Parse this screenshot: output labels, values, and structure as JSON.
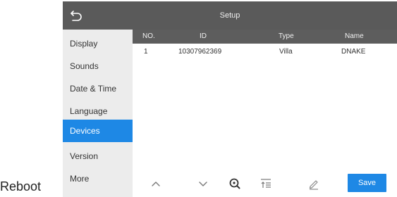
{
  "outside_label": "Reboot",
  "header": {
    "title": "Setup",
    "back_icon": "back-icon"
  },
  "sidebar": {
    "items": [
      {
        "label": "Display"
      },
      {
        "label": "Sounds"
      },
      {
        "label": "Date & Time"
      },
      {
        "label": "Language"
      },
      {
        "label": "Devices"
      },
      {
        "label": "Version"
      },
      {
        "label": "More"
      }
    ],
    "active": "Devices",
    "active_color": "#1e88e5"
  },
  "table": {
    "columns": [
      "NO.",
      "ID",
      "Type",
      "Name"
    ],
    "rows": [
      {
        "no": "1",
        "id": "10307962369",
        "type": "Villa",
        "name": "DNAKE"
      }
    ]
  },
  "toolbar": {
    "icons": [
      "chevron-up-icon",
      "chevron-down-icon",
      "search-icon",
      "sort-icon",
      "edit-icon"
    ],
    "save_label": "Save"
  }
}
